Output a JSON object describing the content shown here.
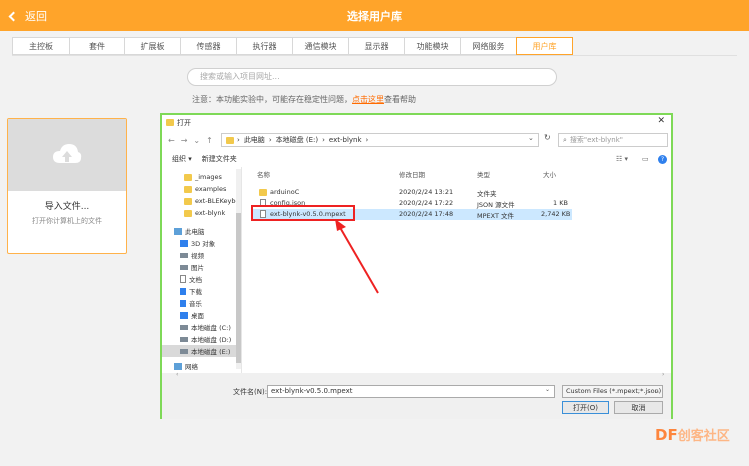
{
  "header": {
    "back_label": "返回",
    "title": "选择用户库"
  },
  "tabs": [
    "主控板",
    "套件",
    "扩展板",
    "传感器",
    "执行器",
    "通信模块",
    "显示器",
    "功能模块",
    "网络服务",
    "用户库"
  ],
  "active_tab": "用户库",
  "search": {
    "placeholder": "搜索或输入项目网址..."
  },
  "notice": {
    "text": "注意：本功能实验中，可能存在稳定性问题，",
    "link": "点击这里",
    "tail": "查看帮助"
  },
  "import_card": {
    "title": "导入文件...",
    "subtitle": "打开你计算机上的文件"
  },
  "dialog": {
    "title": "打开",
    "address": [
      "此电脑",
      "本地磁盘 (E:)",
      "ext-blynk"
    ],
    "search_placeholder": "搜索\"ext-blynk\"",
    "toolbar": {
      "organize": "组织 ▾",
      "new_folder": "新建文件夹"
    },
    "nav_folders": [
      "_images",
      "examples",
      "ext-BLEKeyboa",
      "ext-blynk"
    ],
    "nav_pc": "此电脑",
    "nav_pc_items": [
      {
        "label": "3D 对象",
        "icon": "cube-icon"
      },
      {
        "label": "视频",
        "icon": "video-icon"
      },
      {
        "label": "图片",
        "icon": "picture-icon"
      },
      {
        "label": "文档",
        "icon": "document-icon"
      },
      {
        "label": "下载",
        "icon": "download-icon"
      },
      {
        "label": "音乐",
        "icon": "music-icon"
      },
      {
        "label": "桌面",
        "icon": "desktop-icon"
      },
      {
        "label": "本地磁盘 (C:)",
        "icon": "drive-icon"
      },
      {
        "label": "本地磁盘 (D:)",
        "icon": "drive-icon"
      },
      {
        "label": "本地磁盘 (E:)",
        "icon": "drive-icon"
      }
    ],
    "nav_network": "网络",
    "columns": {
      "name": "名称",
      "date": "修改日期",
      "type": "类型",
      "size": "大小"
    },
    "files": [
      {
        "name": "arduinoC",
        "date": "2020/2/24 13:21",
        "type": "文件夹",
        "size": ""
      },
      {
        "name": "config.json",
        "date": "2020/2/24 17:22",
        "type": "JSON 源文件",
        "size": "1 KB"
      },
      {
        "name": "ext-blynk-v0.5.0.mpext",
        "date": "2020/2/24 17:48",
        "type": "MPEXT 文件",
        "size": "2,742 KB"
      }
    ],
    "filename_label": "文件名(N):",
    "filename_value": "ext-blynk-v0.5.0.mpext",
    "filter": "Custom Files (*.mpext;*.json)",
    "open_button": "打开(O)",
    "cancel_button": "取消"
  },
  "watermark": {
    "brand": "DF",
    "text": "创客社区"
  },
  "colors": {
    "accent": "#ffa42a",
    "highlight": "#e22222",
    "dialog_border": "#7ed957"
  }
}
